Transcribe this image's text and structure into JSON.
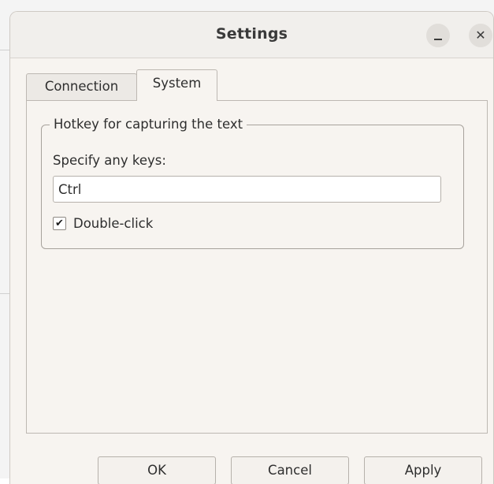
{
  "window": {
    "title": "Settings",
    "minimize_symbol": "–",
    "close_symbol": "✕"
  },
  "tabs": [
    {
      "label": "Connection",
      "active": false
    },
    {
      "label": "System",
      "active": true
    }
  ],
  "hotkey_group": {
    "title": "Hotkey for capturing the text",
    "keys_label": "Specify any keys:",
    "keys_value": "Ctrl",
    "double_click": {
      "label": "Double-click",
      "checked": true,
      "check_glyph": "✔"
    }
  },
  "buttons": {
    "ok": "OK",
    "cancel": "Cancel",
    "apply": "Apply"
  },
  "icons": {
    "minimize": "minimize-icon",
    "close": "close-icon",
    "check": "checkmark-icon"
  }
}
